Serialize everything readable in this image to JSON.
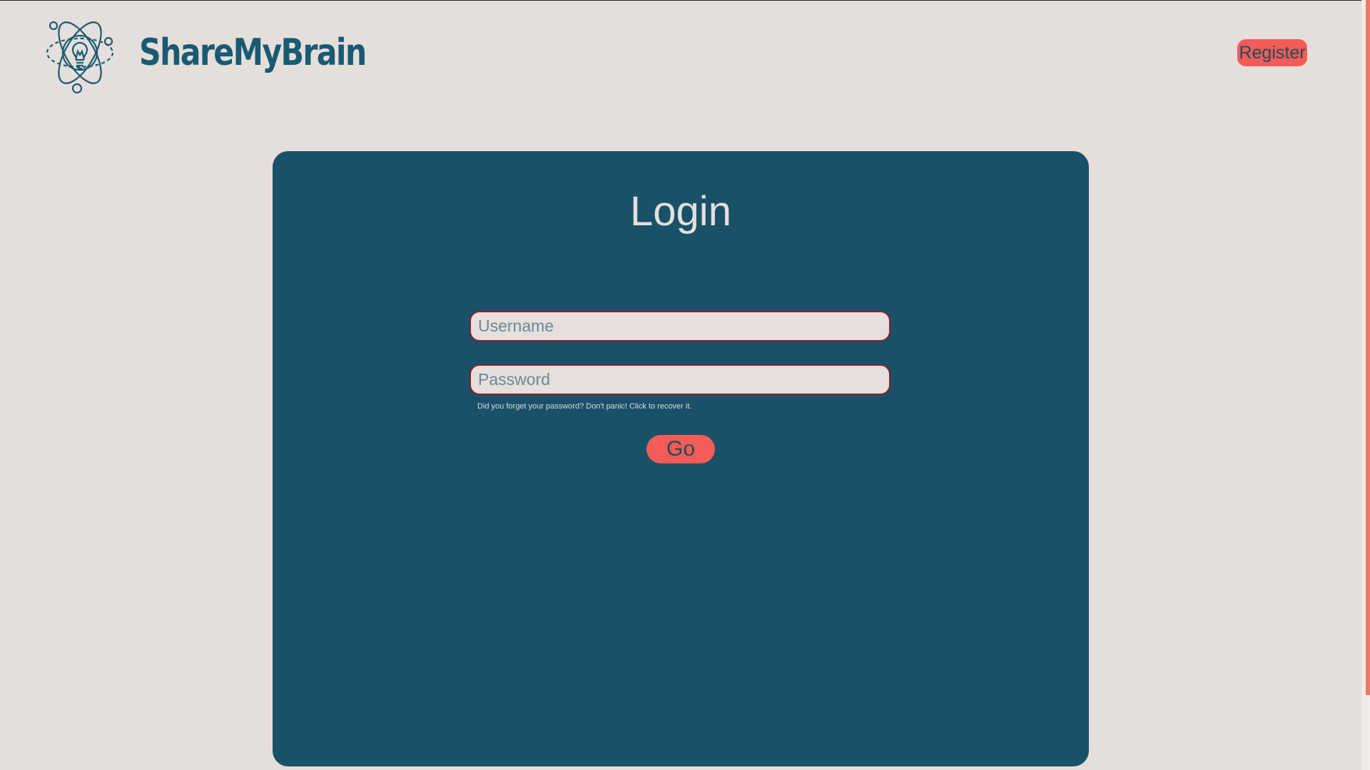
{
  "header": {
    "brand_name": "ShareMyBrain",
    "logo_icon": "atom-lightbulb-icon",
    "register_label": "Register"
  },
  "login": {
    "title": "Login",
    "username_placeholder": "Username",
    "username_value": "",
    "password_placeholder": "Password",
    "password_value": "",
    "forgot_text": "Did you forget your password? Don't panic! Click to recover it.",
    "submit_label": "Go"
  },
  "colors": {
    "background": "#e5dfdc",
    "brand": "#1a5a72",
    "card": "#195169",
    "accent": "#f35c57",
    "input_border": "#8a1f2a"
  }
}
